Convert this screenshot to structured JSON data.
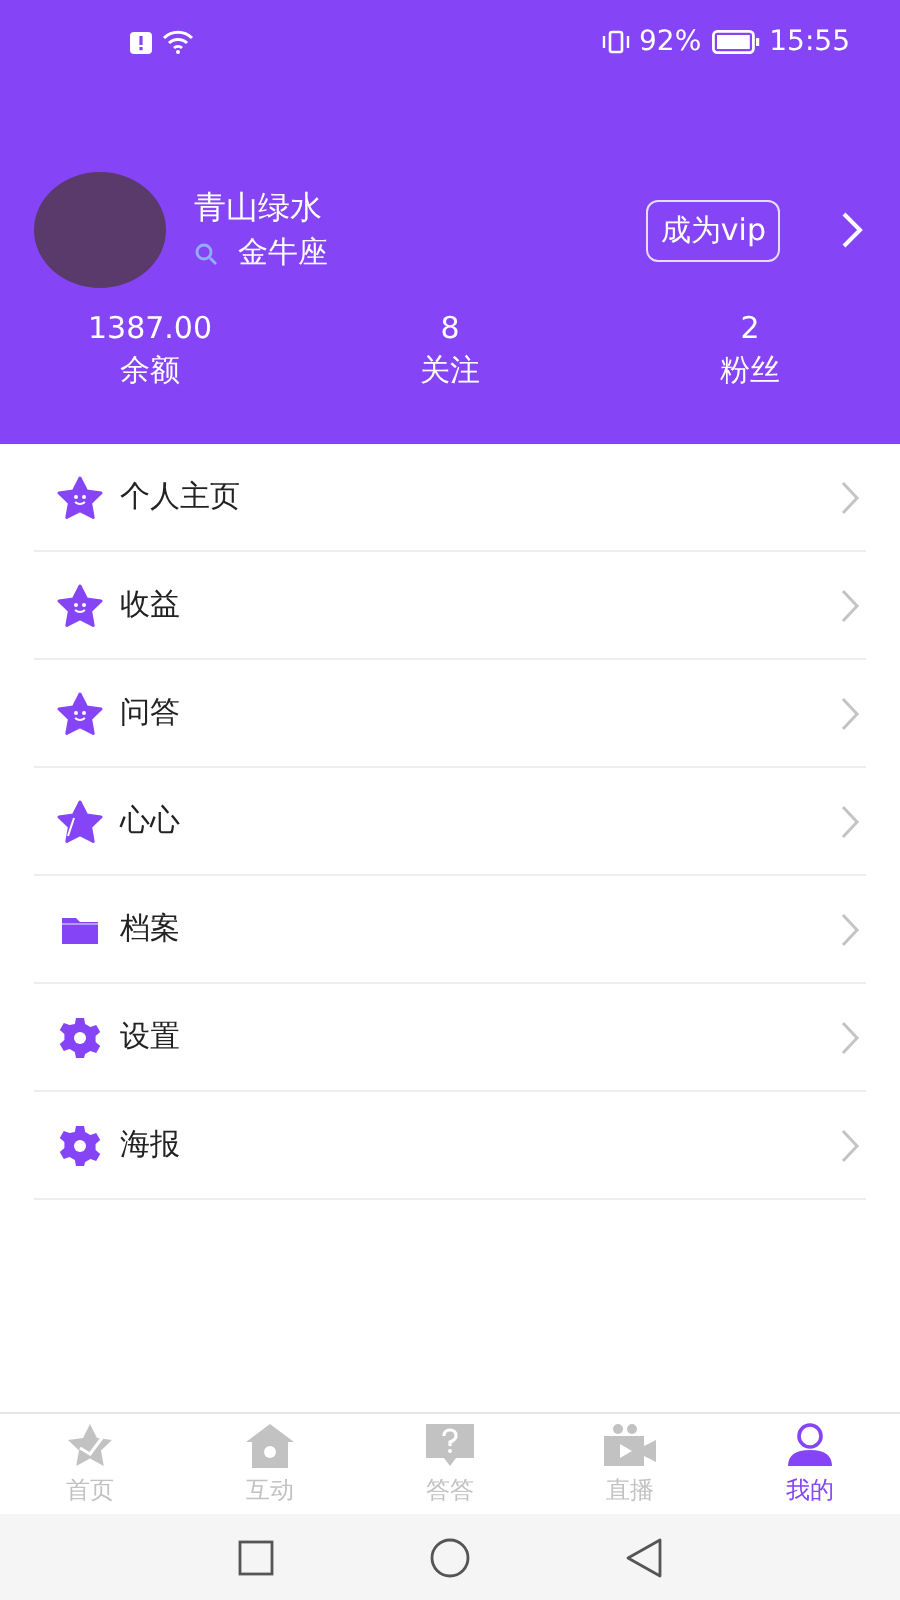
{
  "status_bar": {
    "battery": "92%",
    "time": "15:55"
  },
  "profile": {
    "name": "青山绿水",
    "sign": "金牛座",
    "vip_button": "成为vip"
  },
  "stats": [
    {
      "value": "1387.00",
      "label": "余额"
    },
    {
      "value": "8",
      "label": "关注"
    },
    {
      "value": "2",
      "label": "粉丝"
    }
  ],
  "menu": [
    {
      "label": "个人主页",
      "kind": "star"
    },
    {
      "label": "收益",
      "kind": "star"
    },
    {
      "label": "问答",
      "kind": "star"
    },
    {
      "label": "心心",
      "kind": "star-sparkle"
    },
    {
      "label": "档案",
      "kind": "folder"
    },
    {
      "label": "设置",
      "kind": "gear"
    },
    {
      "label": "海报",
      "kind": "gear"
    }
  ],
  "tabs": [
    {
      "label": "首页",
      "kind": "star",
      "selected": false
    },
    {
      "label": "互动",
      "kind": "house",
      "selected": false
    },
    {
      "label": "答答",
      "kind": "question",
      "selected": false
    },
    {
      "label": "直播",
      "kind": "camera",
      "selected": false
    },
    {
      "label": "我的",
      "kind": "person",
      "selected": true
    }
  ]
}
